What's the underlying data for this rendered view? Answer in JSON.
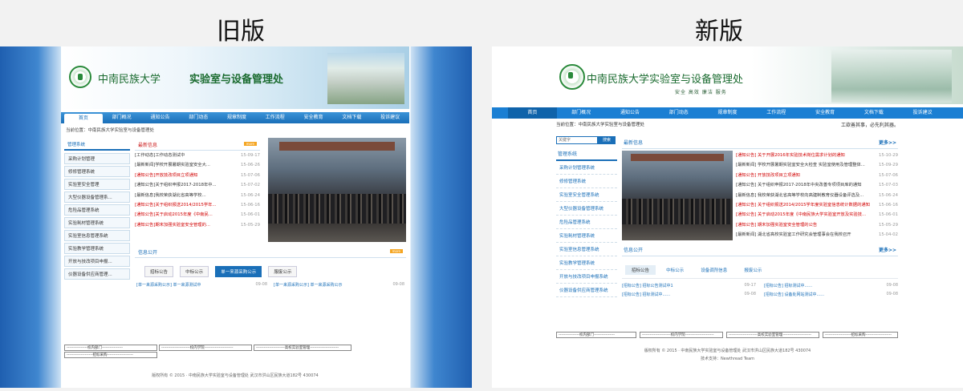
{
  "labels": {
    "old": "旧版",
    "new": "新版"
  },
  "old": {
    "univ": "中南民族大学",
    "dept": "实验室与设备管理处",
    "nav": [
      "首页",
      "部门概况",
      "通知公告",
      "部门动态",
      "规章制度",
      "工作流程",
      "安全教育",
      "文档下载",
      "投诉建议"
    ],
    "crumb": "当前位置：中南民族大学实验室与设备管理处",
    "side_title": "管理系统",
    "side": [
      "采购计划管理",
      "修修管理系统",
      "实验室安全管理",
      "大型仪器设备管理系...",
      "危险品管理系统",
      "实验耗材管理系统",
      "实验室信息管理系统",
      "实验教学管理系统",
      "开放与技改项目申报...",
      "仪器设备供应商管理..."
    ],
    "news_title": "最新信息",
    "more": "more",
    "news": [
      {
        "t": "[工作动态]工作动态测试中",
        "d": "15-09-17",
        "red": false
      },
      {
        "t": "[最新新闻]学校开展暑期实验室安全大...",
        "d": "15-06-26",
        "red": false
      },
      {
        "t": "[通知公告]开放技改项目立项通知",
        "d": "15-07-06",
        "red": true
      },
      {
        "t": "[通知公告]关于组织申报2017-2018年中...",
        "d": "15-07-02",
        "red": false
      },
      {
        "t": "[最新信息]我校荣获湖北省高等学校...",
        "d": "15-06-24",
        "red": false
      },
      {
        "t": "[通知公告]关于组织报送2014/2015学年...",
        "d": "15-06-16",
        "red": true
      },
      {
        "t": "[通知公告]关于启动2015年度《中南民...",
        "d": "15-06-01",
        "red": true
      },
      {
        "t": "[通知公告]期末加强实验室安全管理的...",
        "d": "15-05-29",
        "red": true
      }
    ],
    "info_title": "信息公开",
    "tabs": [
      "招标公告",
      "中标公示",
      "单一来源采购公示",
      "服废公示"
    ],
    "info": [
      {
        "t": "[单一来源采购公示] 单一来源测试中",
        "d": "09-08"
      },
      {
        "t": "[单一来源采购公示] 单一来源采购公示",
        "d": "09-08"
      }
    ],
    "selects": [
      "----------------校内部门----------------",
      "----------------------校内学院----------------------",
      "----------------------高校实验室管理----------------------",
      "--------------------招标采购--------------------"
    ],
    "footer": "版权所有 © 2015 · 中南民族大学实验室与设备管理处  武汉市洪山区民族大道182号 430074"
  },
  "new": {
    "univ": "中南民族大学",
    "dept": "实验室与设备管理处",
    "slogan": "安全 高效 廉洁 服务",
    "nav": [
      "首页",
      "部门概况",
      "通知公告",
      "部门动态",
      "规章制度",
      "工作流程",
      "安全教育",
      "文档下载",
      "投诉建议"
    ],
    "crumb": "当前位置：中南民族大学实验室与设备管理处",
    "marquee": "工欲善其事，必先利其器。",
    "search_placeholder": "关键字",
    "search_btn": "搜索",
    "side_title": "管理系统",
    "side": [
      "采购计划管理系统",
      "修修管理系统",
      "实验室安全管理系统",
      "大型仪器设备管理系统",
      "危险品管理系统",
      "实验耗材管理系统",
      "实验室信息管理系统",
      "实验教学管理系统",
      "开放与技改项目申报系统",
      "仪器设备供应商管理系统"
    ],
    "news_title": "最新信息",
    "more": "更多>>",
    "news": [
      {
        "t": "[通知公告] 关于开展2016年实验技术岗位需求计划的通知",
        "d": "15-10-29",
        "red": true
      },
      {
        "t": "[最新新闻] 学校开展暑期实验室安全大检查 实验室使用及管理整体...",
        "d": "15-09-29",
        "red": false
      },
      {
        "t": "[通知公告] 开放技改项目立项通知",
        "d": "15-07-06",
        "red": true
      },
      {
        "t": "[通知公告] 关于组织申报2017-2018年中央改善专项项目库的通知",
        "d": "15-07-03",
        "red": false
      },
      {
        "t": "[最新信息] 我校荣获湖北省高等学校向高建制教育仪器设备评选及...",
        "d": "15-06-24",
        "red": false
      },
      {
        "t": "[通知公告] 关于组织报送2014/2015学年度实验室信息统计数据的通知",
        "d": "15-06-16",
        "red": true
      },
      {
        "t": "[通知公告] 关于启动2015年度《中南民族大学实验室开放及实验技...",
        "d": "15-06-01",
        "red": true
      },
      {
        "t": "[通知公告] 期末加强实验室安全管理的公告",
        "d": "15-05-29",
        "red": true
      },
      {
        "t": "[最新新闻] 湖北省高校实验室工作研究会管理事会在我校召开",
        "d": "15-04-02",
        "red": false
      }
    ],
    "info_title": "信息公开",
    "tabs": [
      "招标公告",
      "中标公示",
      "设备调剂信息",
      "报废公示"
    ],
    "info": [
      {
        "t": "[招标公告] 招标公告测试中1",
        "d": "09-17"
      },
      {
        "t": "[招标公告] 招标测试中......",
        "d": "09-08"
      },
      {
        "t": "[招标公告] 招标测试中......",
        "d": "09-08"
      },
      {
        "t": "[招标公告] 设备处网站测试中......",
        "d": "09-08"
      }
    ],
    "selects": [
      "----------------校内部门----------------",
      "----------------------校内学院----------------------",
      "----------------------高校实验室管理----------------------",
      "--------------------招标采购--------------------"
    ],
    "footer": "版权所有 © 2015 · 中南民族大学实验室与设备管理处  武汉市洪山区民族大道182号 430074",
    "support": "技术支持：Newthread Team"
  }
}
